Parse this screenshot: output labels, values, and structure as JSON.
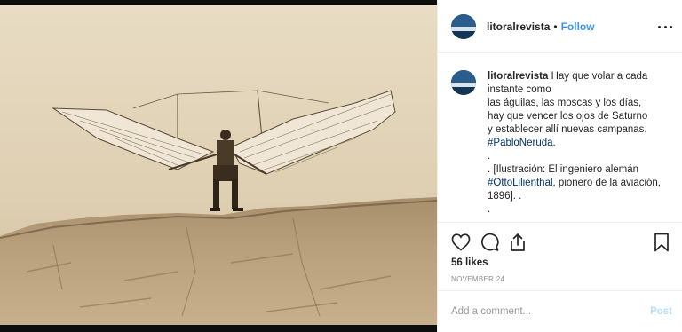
{
  "post": {
    "username": "litoralrevista",
    "separator": "•",
    "follow_label": "Follow",
    "more_icon": "more-options-icon"
  },
  "caption": {
    "username": "litoralrevista",
    "lines": [
      "Hay que volar a cada",
      "instante como",
      "las águilas, las moscas y los días,",
      "hay que vencer los ojos de Saturno",
      "y establecer allí nuevas campanas."
    ],
    "hashtag_1": "#PabloNeruda",
    "after_hashtag_1": ".",
    "dot_line": ".",
    "illustration_prefix": ". [Ilustración: El ingeniero alemán",
    "hashtag_2": "#OttoLilienthal",
    "after_hashtag_2": ", pionero de la aviación,",
    "year_line": "1896]. .",
    "final_dot": "."
  },
  "actions": {
    "icons": [
      "heart-icon",
      "comment-icon",
      "share-icon",
      "bookmark-icon"
    ],
    "likes": "56 likes",
    "date": "NOVEMBER 24"
  },
  "comment_box": {
    "placeholder": "Add a comment...",
    "post_label": "Post",
    "post_color": "#b2dffc"
  },
  "colors": {
    "link": "#3897f0",
    "hashtag": "#003569",
    "photo_sepia": "#d9c9ad"
  }
}
